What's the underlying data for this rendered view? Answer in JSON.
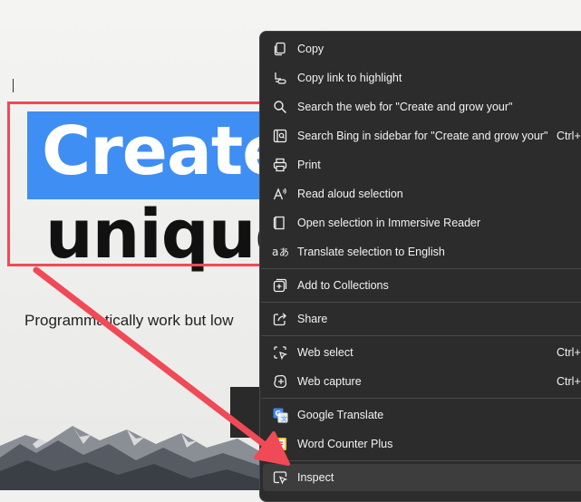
{
  "page": {
    "headline_line1": "Create",
    "headline_line2": "unique",
    "subtitle": "Programmatically work but low"
  },
  "context_menu": {
    "items": [
      {
        "label": "Copy",
        "icon": "copy-icon"
      },
      {
        "label": "Copy link to highlight",
        "icon": "link-highlight-icon"
      },
      {
        "label": "Search the web for \"Create and grow your\"",
        "icon": "search-icon"
      },
      {
        "label": "Search Bing in sidebar for \"Create and grow your\"",
        "icon": "sidebar-search-icon",
        "shortcut": "Ctrl+"
      },
      {
        "label": "Print",
        "icon": "print-icon"
      },
      {
        "label": "Read aloud selection",
        "icon": "read-aloud-icon"
      },
      {
        "label": "Open selection in Immersive Reader",
        "icon": "immersive-reader-icon"
      },
      {
        "label": "Translate selection to English",
        "icon": "translate-icon"
      },
      {
        "label": "Add to Collections",
        "icon": "collections-icon"
      },
      {
        "label": "Share",
        "icon": "share-icon"
      },
      {
        "label": "Web select",
        "icon": "web-select-icon",
        "shortcut": "Ctrl+"
      },
      {
        "label": "Web capture",
        "icon": "web-capture-icon",
        "shortcut": "Ctrl+"
      },
      {
        "label": "Google Translate",
        "icon": "google-translate-icon"
      },
      {
        "label": "Word Counter Plus",
        "icon": "word-counter-icon"
      },
      {
        "label": "Inspect",
        "icon": "inspect-icon"
      }
    ]
  },
  "colors": {
    "selection": "#3f8ef3",
    "annotation_red": "#ef4a56",
    "menu_bg": "#2c2c2c"
  }
}
